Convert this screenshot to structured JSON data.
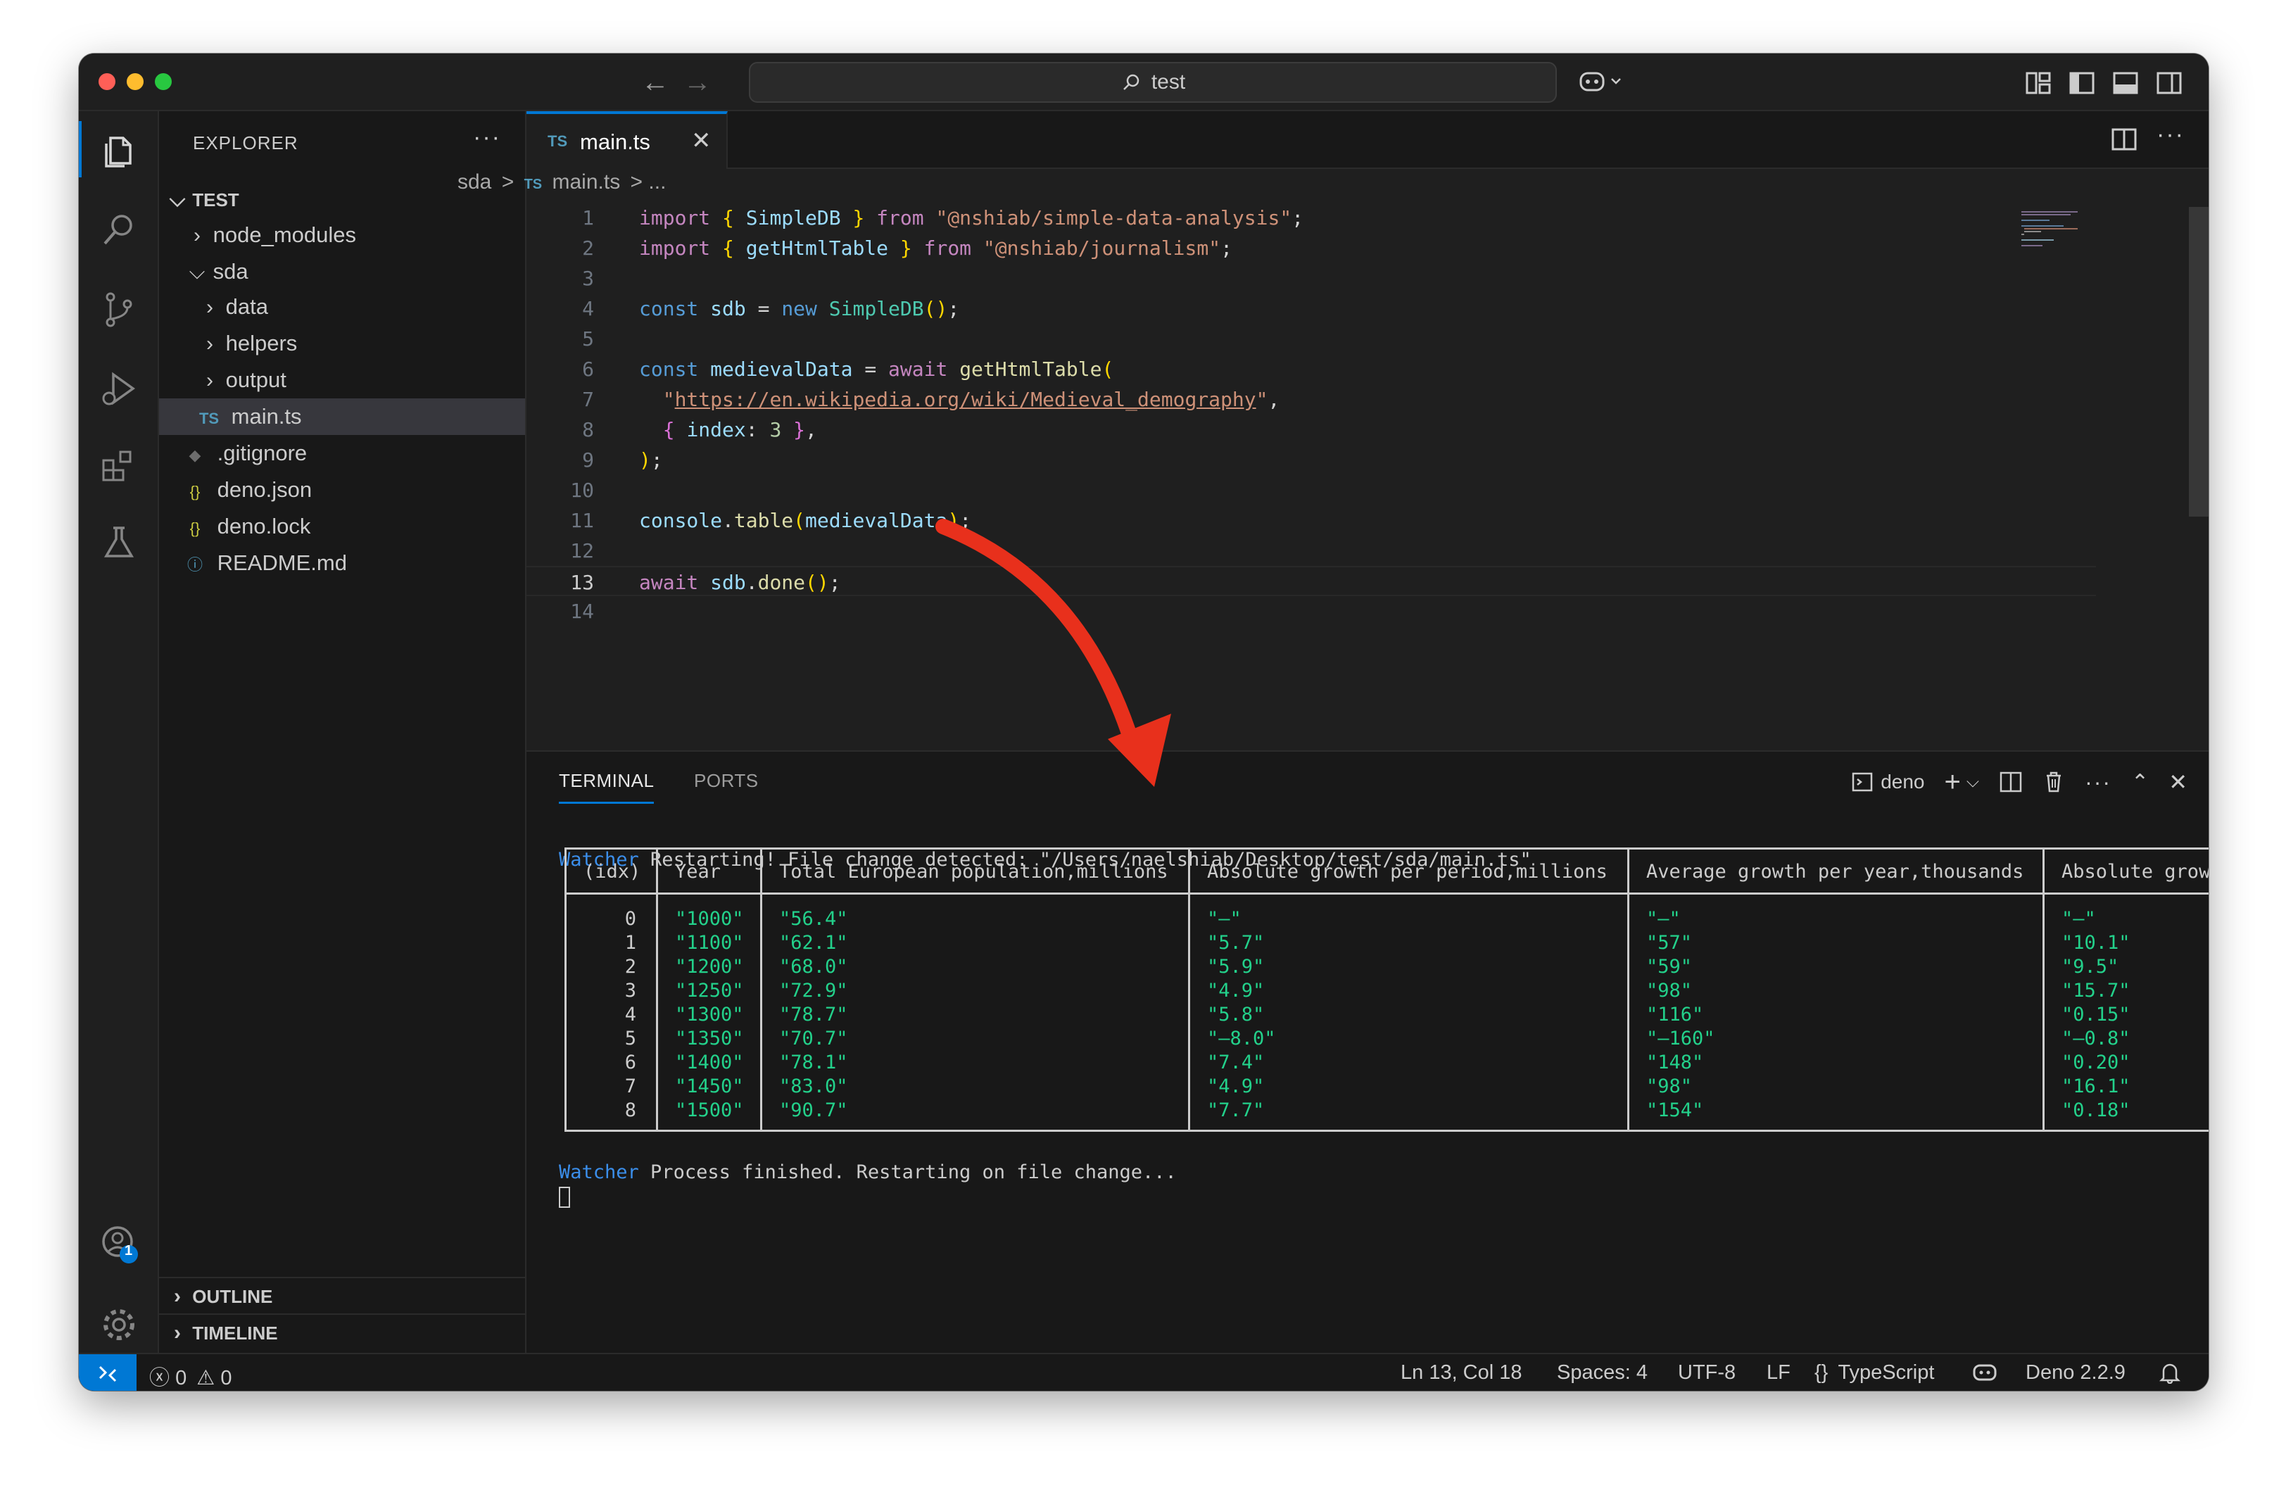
{
  "titlebar": {
    "search_text": "test",
    "back_icon": "arrow-left-icon",
    "forward_icon": "arrow-right-icon",
    "copilot_icon": "copilot-icon"
  },
  "activity_bar": {
    "items": [
      "explorer",
      "search",
      "source-control",
      "run-and-debug",
      "extensions",
      "testing"
    ],
    "accounts_badge": "1"
  },
  "sidebar": {
    "header": "EXPLORER",
    "more": "···",
    "root": "TEST",
    "items": [
      {
        "label": "node_modules",
        "type": "folder",
        "expanded": false
      },
      {
        "label": "sda",
        "type": "folder",
        "expanded": true
      },
      {
        "label": "data",
        "type": "folder",
        "expanded": false
      },
      {
        "label": "helpers",
        "type": "folder",
        "expanded": false
      },
      {
        "label": "output",
        "type": "folder",
        "expanded": false
      },
      {
        "label": "main.ts",
        "type": "ts",
        "selected": true
      },
      {
        "label": ".gitignore",
        "type": "git"
      },
      {
        "label": "deno.json",
        "type": "json"
      },
      {
        "label": "deno.lock",
        "type": "json"
      },
      {
        "label": "README.md",
        "type": "info"
      }
    ],
    "outline": "OUTLINE",
    "timeline": "TIMELINE"
  },
  "editor": {
    "tab_badge": "TS",
    "tab_label": "main.ts",
    "tab_close": "✕",
    "breadcrumb": {
      "folder": "sda",
      "sep": ">",
      "badge": "TS",
      "file": "main.ts",
      "rest": "> ..."
    },
    "line_numbers": [
      "1",
      "2",
      "3",
      "4",
      "5",
      "6",
      "7",
      "8",
      "9",
      "10",
      "11",
      "12",
      "13",
      "14"
    ],
    "current_line": "13"
  },
  "panel": {
    "tabs": [
      "TERMINAL",
      "PORTS"
    ],
    "terminal_name": "deno",
    "watcher_label": "Watcher",
    "restart_msg": " Restarting! File change detected: \"/Users/naelshiab/Desktop/test/sda/main.ts\"",
    "finished_msg": " Process finished. Restarting on file change...",
    "table": {
      "headers": [
        "(idx)",
        "Year",
        "Total European population,millions",
        "Absolute growth per period,millions",
        "Average growth per year,thousands",
        "Absolute growt"
      ],
      "idx": [
        "0",
        "1",
        "2",
        "3",
        "4",
        "5",
        "6",
        "7",
        "8"
      ],
      "year": [
        "\"1000\"",
        "\"1100\"",
        "\"1200\"",
        "\"1250\"",
        "\"1300\"",
        "\"1350\"",
        "\"1400\"",
        "\"1450\"",
        "\"1500\""
      ],
      "population": [
        "\"56.4\"",
        "\"62.1\"",
        "\"68.0\"",
        "\"72.9\"",
        "\"78.7\"",
        "\"70.7\"",
        "\"78.1\"",
        "\"83.0\"",
        "\"90.7\""
      ],
      "abs_growth": [
        "\"–\"",
        "\"5.7\"",
        "\"5.9\"",
        "\"4.9\"",
        "\"5.8\"",
        "\"–8.0\"",
        "\"7.4\"",
        "\"4.9\"",
        "\"7.7\""
      ],
      "avg_growth": [
        "\"–\"",
        "\"57\"",
        "\"59\"",
        "\"98\"",
        "\"116\"",
        "\"–160\"",
        "\"148\"",
        "\"98\"",
        "\"154\""
      ],
      "abs_growth2": [
        "\"–\"",
        "\"10.1\"",
        "\"9.5\"",
        "\"15.7\"",
        "\"0.15\"",
        "\"–0.8\"",
        "\"0.20\"",
        "\"16.1\"",
        "\"0.18\""
      ]
    }
  },
  "statusbar": {
    "errors": "0",
    "warnings": "0",
    "position": "Ln 13, Col 18",
    "spaces": "Spaces: 4",
    "encoding": "UTF-8",
    "eol": "LF",
    "language": "TypeScript",
    "runtime": "Deno 2.2.9"
  },
  "colors": {
    "accent": "#0078d4",
    "arrow": "#e8301c",
    "terminal_green": "#23d18b"
  }
}
